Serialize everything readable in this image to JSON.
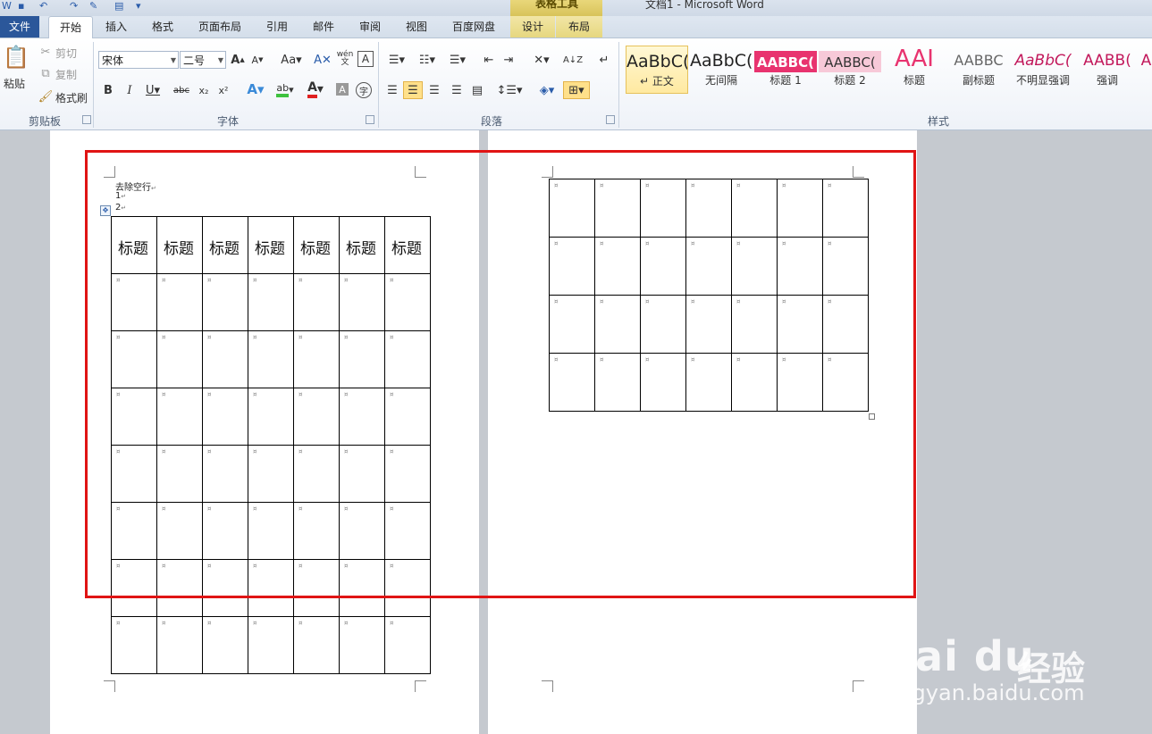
{
  "window": {
    "title": "文档1 - Microsoft Word",
    "context_tab_group": "表格工具"
  },
  "tabs": [
    "文件",
    "开始",
    "插入",
    "格式",
    "页面布局",
    "引用",
    "邮件",
    "审阅",
    "视图",
    "百度网盘",
    "设计",
    "布局"
  ],
  "clipboard": {
    "paste": "粘贴",
    "cut": "剪切",
    "copy": "复制",
    "format_painter": "格式刷",
    "group": "剪贴板"
  },
  "font": {
    "name": "宋体",
    "size": "二号",
    "group": "字体",
    "aa": "Aa",
    "wen": "wén"
  },
  "paragraph": {
    "group": "段落"
  },
  "styles": {
    "group": "样式",
    "items": [
      {
        "preview": "AaBbC(",
        "name": "正文"
      },
      {
        "preview": "AaBbC(",
        "name": "无间隔"
      },
      {
        "preview": "AABBC(",
        "name": "标题 1"
      },
      {
        "preview": "AABBC(",
        "name": "标题 2"
      },
      {
        "preview": "AAI",
        "name": "标题"
      },
      {
        "preview": "AABBC",
        "name": "副标题"
      },
      {
        "preview": "AaBbC(",
        "name": "不明显强调"
      },
      {
        "preview": "AABB(",
        "name": "强调"
      },
      {
        "preview": "A",
        "name": ""
      }
    ]
  },
  "document": {
    "line1": "去除空行",
    "line2": "1",
    "line3": "2",
    "header_cell": "标题",
    "page1_rows": 8,
    "page2_rows": 4,
    "columns": 7
  },
  "watermark": {
    "logo": "Bai du",
    "cn": "经验",
    "url": "jingyan.baidu.com"
  },
  "colors": {
    "file_tab": "#2b579a",
    "highlight_box": "#e01414",
    "style1_pink": "#e8336f"
  }
}
